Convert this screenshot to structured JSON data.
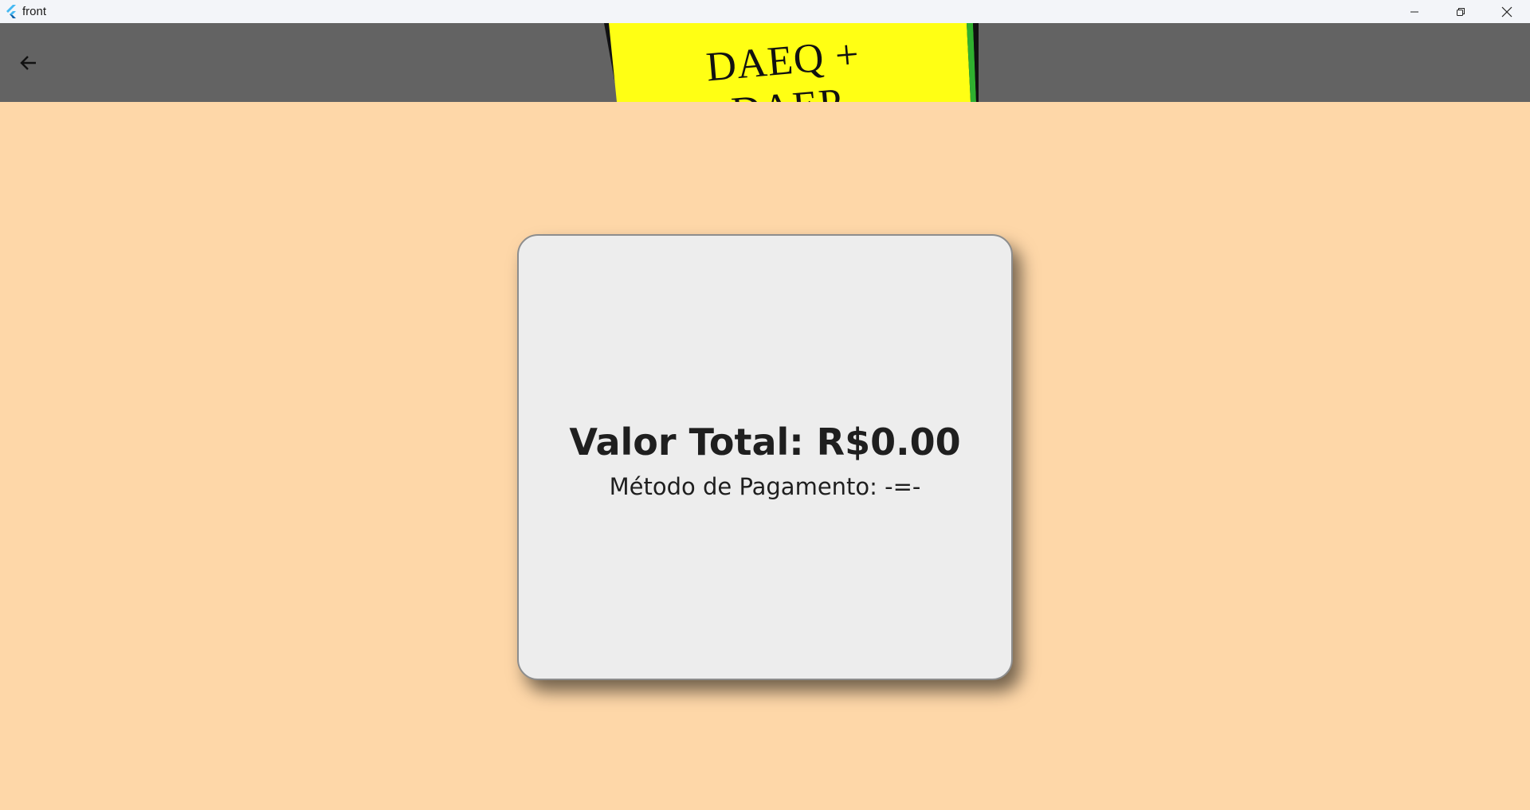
{
  "window": {
    "title": "front",
    "controls": {
      "minimize": "minimize-icon",
      "maximize": "restore-icon",
      "close": "close-icon"
    }
  },
  "appbar": {
    "back_icon": "arrow-left-icon",
    "logo_text": "DAEQ + DAEP",
    "background": "#636363",
    "logo_background": "#ffff14"
  },
  "card": {
    "total": "Valor Total: R$0.00",
    "method": "Método de Pagamento: -=-"
  },
  "colors": {
    "page_background": "#fed7a8",
    "card_background": "#ededed"
  }
}
